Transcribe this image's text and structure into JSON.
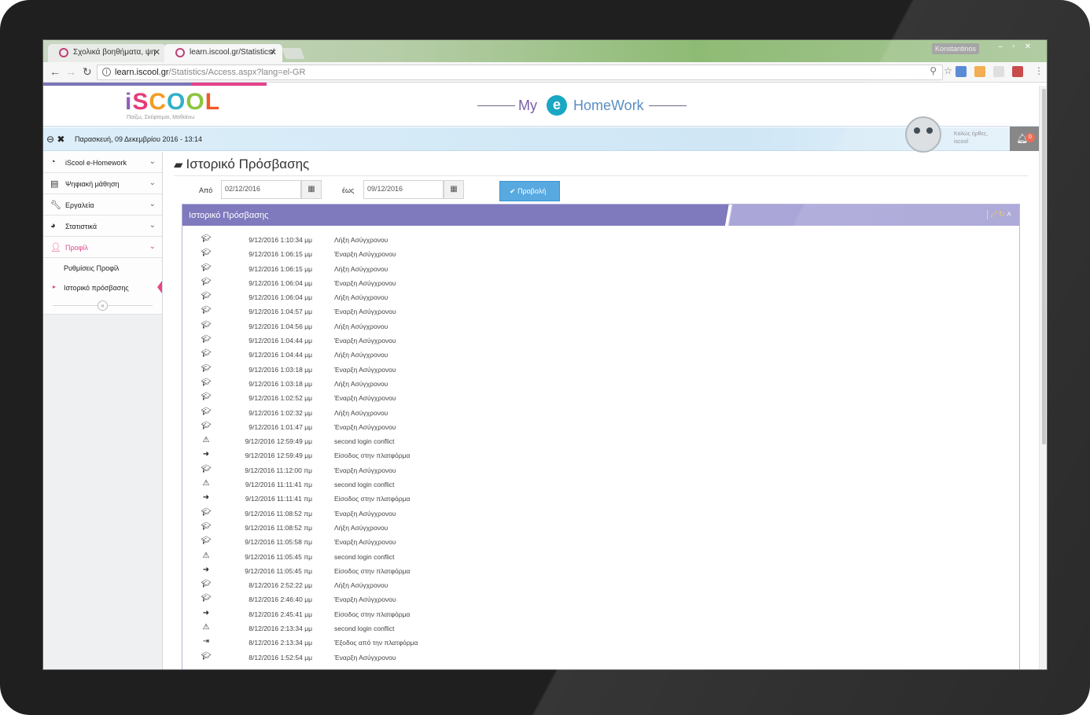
{
  "browser": {
    "tabs": [
      {
        "title": "Σχολικά βοηθήματα, ψη"
      },
      {
        "title": "learn.iscool.gr/Statistics/"
      }
    ],
    "window_user": "Konstantinos",
    "url_host": "learn.iscool.gr",
    "url_path": "/Statistics/Access.aspx?lang=el-GR"
  },
  "header": {
    "logo_letters": [
      "i",
      "S",
      "C",
      "O",
      "O",
      "L"
    ],
    "slogan": "Παίζω, Σκέφτομαι, Μαθαίνω",
    "brand_my": "My",
    "brand_e": "e",
    "brand_homework": "HomeWork"
  },
  "infobar": {
    "date": "Παρασκευή, 09 Δεκεμβρίου 2016 - 13:14",
    "welcome_line1": "Καλώς ήρθες,",
    "welcome_line2": "iscool",
    "notification_count": "0"
  },
  "sidebar": {
    "items": [
      {
        "label": "iScool e-Homework",
        "icon": "dashboard-icon"
      },
      {
        "label": "Ψηφιακή μάθηση",
        "icon": "book-icon"
      },
      {
        "label": "Εργαλεία",
        "icon": "wrench-icon"
      },
      {
        "label": "Στατιστικά",
        "icon": "pie-chart-icon"
      },
      {
        "label": "Προφίλ",
        "icon": "user-icon"
      }
    ],
    "subitems": [
      {
        "label": "Ρυθμίσεις Προφίλ"
      },
      {
        "label": "Ιστορικό πρόσβασης"
      }
    ],
    "collapse_glyph": "«"
  },
  "page": {
    "title": "Ιστορικό Πρόσβασης",
    "from_label": "Από",
    "from_value": "02/12/2016",
    "to_label": "έως",
    "to_value": "09/12/2016",
    "view_button": "Προβολή",
    "panel_title": "Ιστορικό Πρόσβασης"
  },
  "colors": {
    "panel_header": "#7f79bd",
    "accent_pink": "#e6468b",
    "button_blue": "#57a9e0"
  },
  "access_log": [
    {
      "icon": "graduation-cap-icon",
      "time": "9/12/2016 1:10:34 μμ",
      "event": "Λήξη Ασύγχρονου"
    },
    {
      "icon": "graduation-cap-icon",
      "time": "9/12/2016 1:06:15 μμ",
      "event": "Έναρξη Ασύγχρονου"
    },
    {
      "icon": "graduation-cap-icon",
      "time": "9/12/2016 1:06:15 μμ",
      "event": "Λήξη Ασύγχρονου"
    },
    {
      "icon": "graduation-cap-icon",
      "time": "9/12/2016 1:06:04 μμ",
      "event": "Έναρξη Ασύγχρονου"
    },
    {
      "icon": "graduation-cap-icon",
      "time": "9/12/2016 1:06:04 μμ",
      "event": "Λήξη Ασύγχρονου"
    },
    {
      "icon": "graduation-cap-icon",
      "time": "9/12/2016 1:04:57 μμ",
      "event": "Έναρξη Ασύγχρονου"
    },
    {
      "icon": "graduation-cap-icon",
      "time": "9/12/2016 1:04:56 μμ",
      "event": "Λήξη Ασύγχρονου"
    },
    {
      "icon": "graduation-cap-icon",
      "time": "9/12/2016 1:04:44 μμ",
      "event": "Έναρξη Ασύγχρονου"
    },
    {
      "icon": "graduation-cap-icon",
      "time": "9/12/2016 1:04:44 μμ",
      "event": "Λήξη Ασύγχρονου"
    },
    {
      "icon": "graduation-cap-icon",
      "time": "9/12/2016 1:03:18 μμ",
      "event": "Έναρξη Ασύγχρονου"
    },
    {
      "icon": "graduation-cap-icon",
      "time": "9/12/2016 1:03:18 μμ",
      "event": "Λήξη Ασύγχρονου"
    },
    {
      "icon": "graduation-cap-icon",
      "time": "9/12/2016 1:02:52 μμ",
      "event": "Έναρξη Ασύγχρονου"
    },
    {
      "icon": "graduation-cap-icon",
      "time": "9/12/2016 1:02:32 μμ",
      "event": "Λήξη Ασύγχρονου"
    },
    {
      "icon": "graduation-cap-icon",
      "time": "9/12/2016 1:01:47 μμ",
      "event": "Έναρξη Ασύγχρονου"
    },
    {
      "icon": "warning-icon",
      "time": "9/12/2016 12:59:49 μμ",
      "event": "second login conflict"
    },
    {
      "icon": "arrow-right-icon",
      "time": "9/12/2016 12:59:49 μμ",
      "event": "Είσοδος στην πλατφόρμα"
    },
    {
      "icon": "graduation-cap-icon",
      "time": "9/12/2016 11:12:00 πμ",
      "event": "Έναρξη Ασύγχρονου"
    },
    {
      "icon": "warning-icon",
      "time": "9/12/2016 11:11:41 πμ",
      "event": "second login conflict"
    },
    {
      "icon": "arrow-right-icon",
      "time": "9/12/2016 11:11:41 πμ",
      "event": "Είσοδος στην πλατφόρμα"
    },
    {
      "icon": "graduation-cap-icon",
      "time": "9/12/2016 11:08:52 πμ",
      "event": "Έναρξη Ασύγχρονου"
    },
    {
      "icon": "graduation-cap-icon",
      "time": "9/12/2016 11:08:52 πμ",
      "event": "Λήξη Ασύγχρονου"
    },
    {
      "icon": "graduation-cap-icon",
      "time": "9/12/2016 11:05:58 πμ",
      "event": "Έναρξη Ασύγχρονου"
    },
    {
      "icon": "warning-icon",
      "time": "9/12/2016 11:05:45 πμ",
      "event": "second login conflict"
    },
    {
      "icon": "arrow-right-icon",
      "time": "9/12/2016 11:05:45 πμ",
      "event": "Είσοδος στην πλατφόρμα"
    },
    {
      "icon": "graduation-cap-icon",
      "time": "8/12/2016 2:52:22 μμ",
      "event": "Λήξη Ασύγχρονου"
    },
    {
      "icon": "graduation-cap-icon",
      "time": "8/12/2016 2:46:40 μμ",
      "event": "Έναρξη Ασύγχρονου"
    },
    {
      "icon": "arrow-right-icon",
      "time": "8/12/2016 2:45:41 μμ",
      "event": "Είσοδος στην πλατφόρμα"
    },
    {
      "icon": "warning-icon",
      "time": "8/12/2016 2:13:34 μμ",
      "event": "second login conflict"
    },
    {
      "icon": "sign-out-icon",
      "time": "8/12/2016 2:13:34 μμ",
      "event": "Έξοδος από την πλατφόρμα"
    },
    {
      "icon": "graduation-cap-icon",
      "time": "8/12/2016 1:52:54 μμ",
      "event": "Έναρξη Ασύγχρονου"
    }
  ]
}
